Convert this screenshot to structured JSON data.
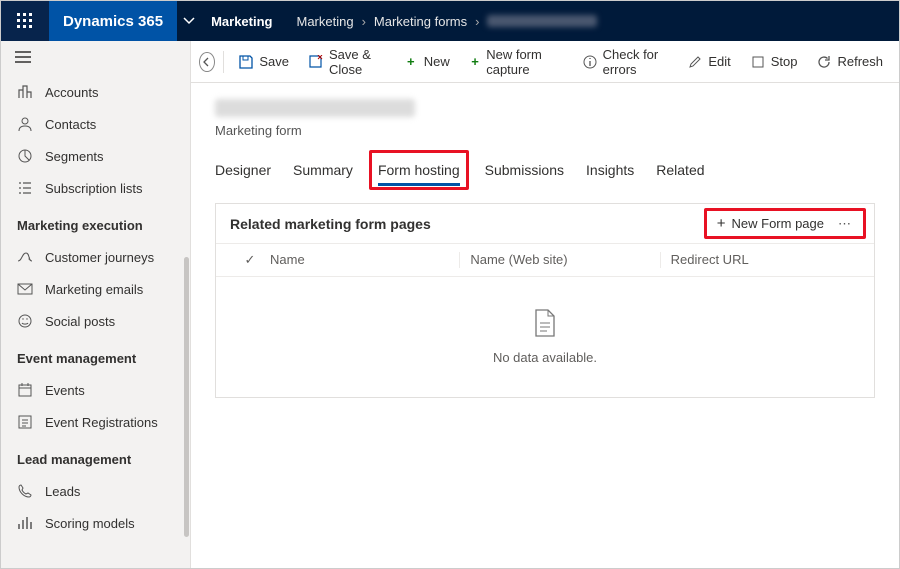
{
  "topbar": {
    "brand": "Dynamics 365",
    "area": "Marketing",
    "breadcrumb": [
      "Marketing",
      "Marketing forms"
    ]
  },
  "sidebar": {
    "groups": [
      {
        "title": "",
        "items": [
          {
            "icon": "build",
            "label": "Accounts"
          },
          {
            "icon": "person",
            "label": "Contacts"
          },
          {
            "icon": "segments",
            "label": "Segments"
          },
          {
            "icon": "list",
            "label": "Subscription lists"
          }
        ]
      },
      {
        "title": "Marketing execution",
        "items": [
          {
            "icon": "journey",
            "label": "Customer journeys"
          },
          {
            "icon": "mail",
            "label": "Marketing emails"
          },
          {
            "icon": "smile",
            "label": "Social posts"
          }
        ]
      },
      {
        "title": "Event management",
        "items": [
          {
            "icon": "calendar",
            "label": "Events"
          },
          {
            "icon": "reglist",
            "label": "Event Registrations"
          }
        ]
      },
      {
        "title": "Lead management",
        "items": [
          {
            "icon": "phone",
            "label": "Leads"
          },
          {
            "icon": "score",
            "label": "Scoring models"
          }
        ]
      }
    ]
  },
  "commands": {
    "save": "Save",
    "save_close": "Save & Close",
    "new": "New",
    "new_capture": "New form capture",
    "check": "Check for errors",
    "edit": "Edit",
    "stop": "Stop",
    "refresh": "Refresh"
  },
  "record": {
    "subtitle": "Marketing form",
    "tabs": [
      "Designer",
      "Summary",
      "Form hosting",
      "Submissions",
      "Insights",
      "Related"
    ],
    "active_tab": 2
  },
  "grid": {
    "title": "Related marketing form pages",
    "new_label": "New Form page",
    "cols": [
      "Name",
      "Name (Web site)",
      "Redirect URL"
    ],
    "empty": "No data available."
  }
}
